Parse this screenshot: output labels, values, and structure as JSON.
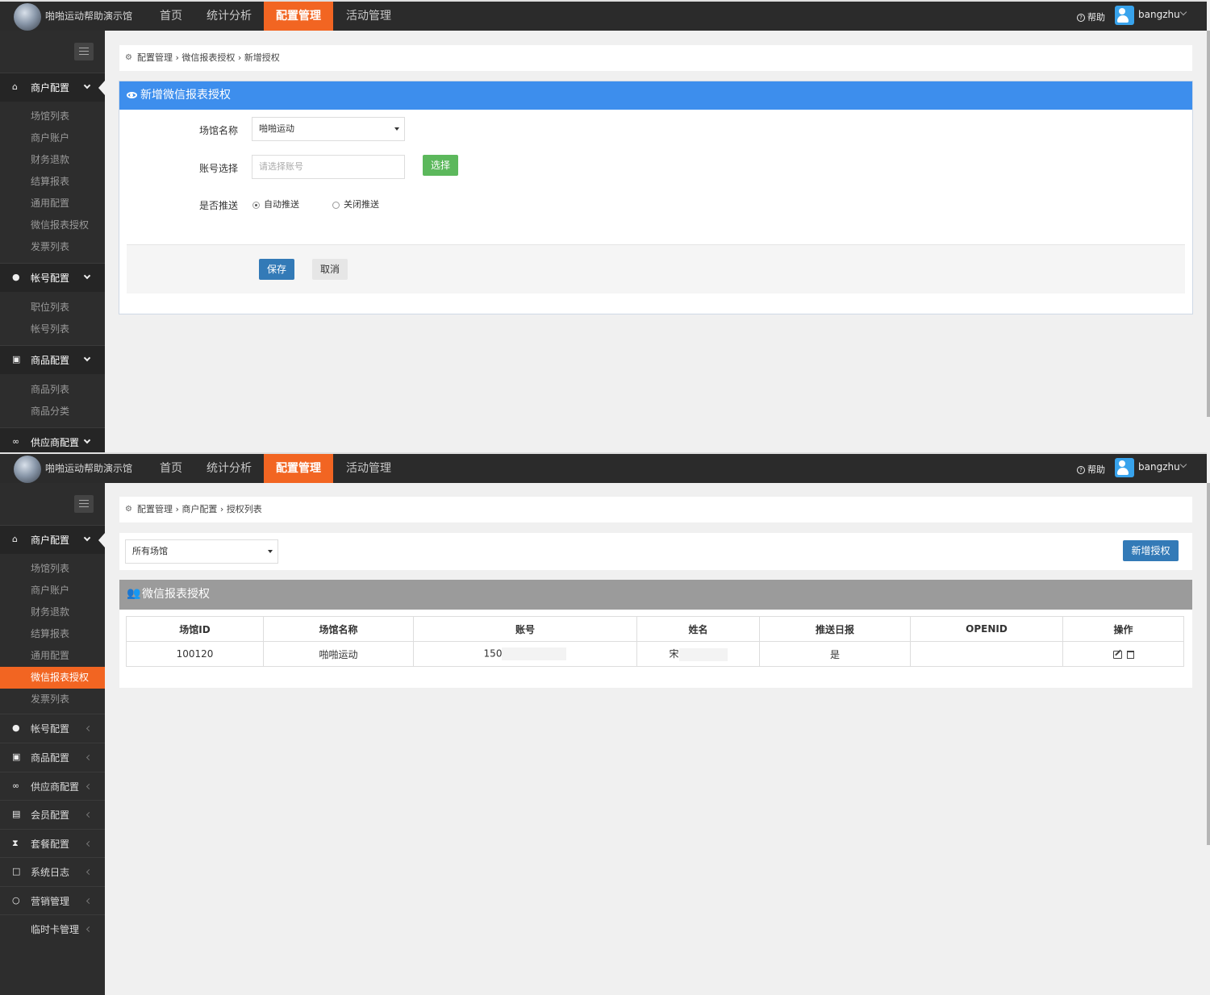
{
  "header": {
    "brand": "啪啪运动帮助演示馆",
    "nav": [
      "首页",
      "统计分析",
      "配置管理",
      "活动管理"
    ],
    "active_nav": "配置管理",
    "help": "帮助",
    "user": "bangzhu"
  },
  "colors": {
    "accent": "#f26522",
    "panel_blue": "#3d8eed",
    "sidebar": "#2d2d2d",
    "save": "#337ab7",
    "select": "#5cb85c"
  },
  "screen1": {
    "sidebar": {
      "groups": [
        {
          "label": "商户配置",
          "icon": "home-icon",
          "expanded": true,
          "items": [
            "场馆列表",
            "商户账户",
            "财务退款",
            "结算报表",
            "通用配置",
            "微信报表授权",
            "发票列表"
          ]
        },
        {
          "label": "帐号配置",
          "icon": "user-icon",
          "expanded": true,
          "items": [
            "职位列表",
            "帐号列表"
          ]
        },
        {
          "label": "商品配置",
          "icon": "gift-icon",
          "expanded": true,
          "items": [
            "商品列表",
            "商品分类"
          ]
        },
        {
          "label": "供应商配置",
          "icon": "link-icon",
          "expanded": true,
          "items": []
        }
      ]
    },
    "breadcrumb": [
      "配置管理",
      "微信报表授权",
      "新增授权"
    ],
    "panel": {
      "title": "新增微信报表授权",
      "venue_label": "场馆名称",
      "venue_value": "啪啪运动",
      "account_label": "账号选择",
      "account_placeholder": "请选择账号",
      "select_button": "选择",
      "push_label": "是否推送",
      "push_options": [
        "自动推送",
        "关闭推送"
      ],
      "push_selected": "自动推送",
      "save": "保存",
      "cancel": "取消"
    }
  },
  "screen2": {
    "sidebar": {
      "groups": [
        {
          "label": "商户配置",
          "icon": "home-icon",
          "expanded": true,
          "items": [
            "场馆列表",
            "商户账户",
            "财务退款",
            "结算报表",
            "通用配置",
            "微信报表授权",
            "发票列表"
          ],
          "active_item": "微信报表授权"
        },
        {
          "label": "帐号配置",
          "icon": "user-icon",
          "expanded": false
        },
        {
          "label": "商品配置",
          "icon": "gift-icon",
          "expanded": false
        },
        {
          "label": "供应商配置",
          "icon": "link-icon",
          "expanded": false
        },
        {
          "label": "会员配置",
          "icon": "id-card-icon",
          "expanded": false
        },
        {
          "label": "套餐配置",
          "icon": "hourglass-icon",
          "expanded": false
        },
        {
          "label": "系统日志",
          "icon": "note-icon",
          "expanded": false
        },
        {
          "label": "营销管理",
          "icon": "chat-icon",
          "expanded": false
        },
        {
          "label": "临时卡管理",
          "icon": "",
          "expanded": false
        }
      ]
    },
    "breadcrumb": [
      "配置管理",
      "商户配置",
      "授权列表"
    ],
    "filter_value": "所有场馆",
    "add_button": "新增授权",
    "table": {
      "title": "微信报表授权",
      "columns": [
        "场馆ID",
        "场馆名称",
        "账号",
        "姓名",
        "推送日报",
        "OPENID",
        "操作"
      ],
      "rows": [
        {
          "venue_id": "100120",
          "venue_name": "啪啪运动",
          "account": "150",
          "name": "宋",
          "push": "是",
          "openid": ""
        }
      ]
    }
  }
}
